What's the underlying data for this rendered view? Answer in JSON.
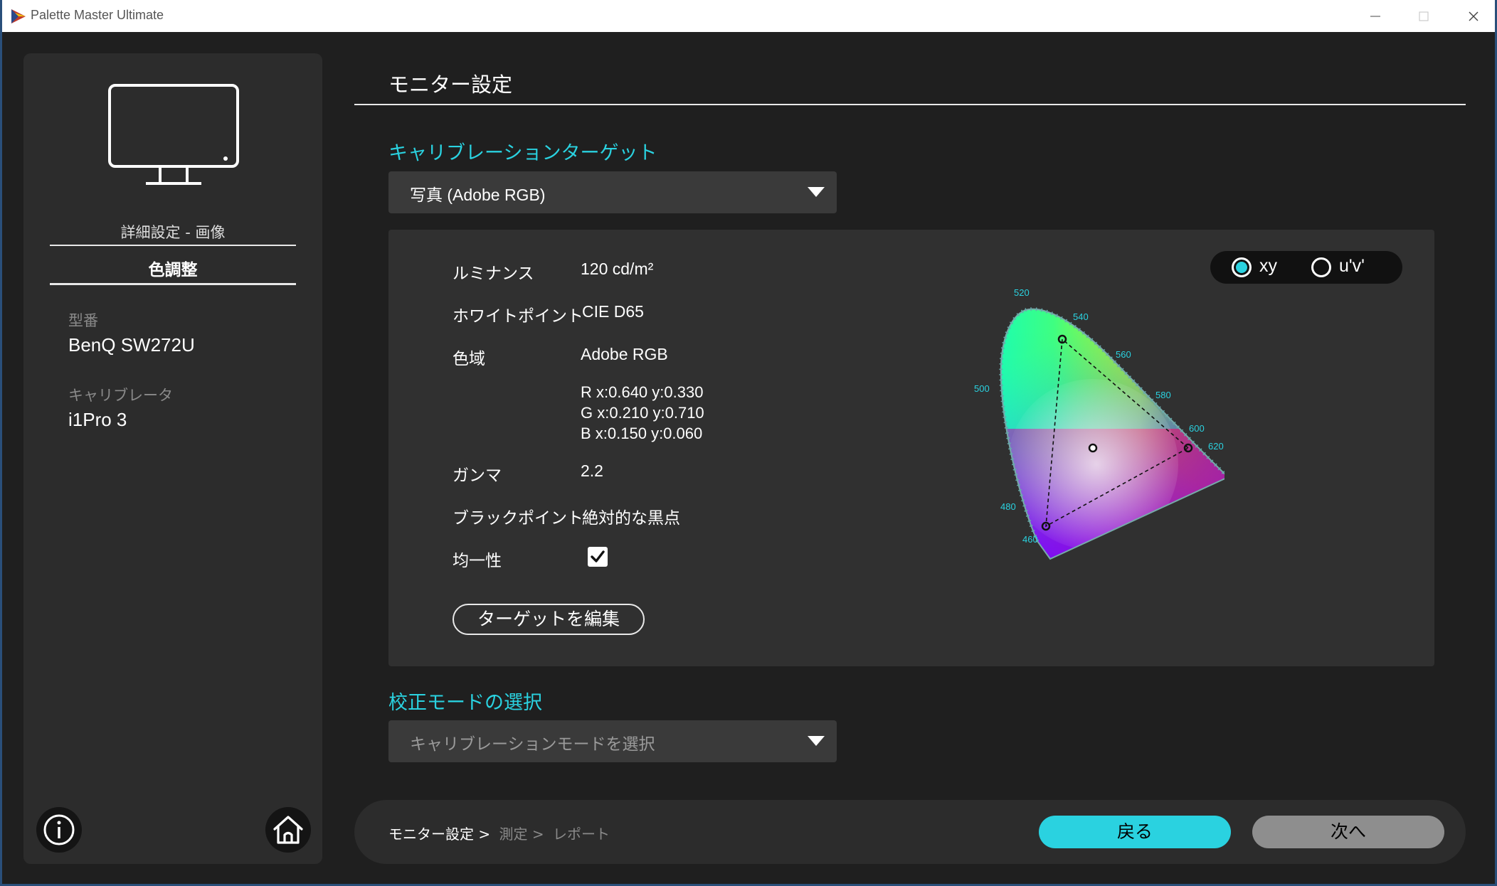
{
  "window": {
    "title": "Palette Master Ultimate"
  },
  "sidebar": {
    "breadcrumb": "詳細設定 - 画像",
    "section": "色調整",
    "model_label": "型番",
    "model_value": "BenQ SW272U",
    "calibrator_label": "キャリブレータ",
    "calibrator_value": "i1Pro 3"
  },
  "main": {
    "title": "モニター設定",
    "target_heading": "キャリブレーションターゲット",
    "target_selected": "写真 (Adobe RGB)",
    "mode_heading": "校正モードの選択",
    "mode_placeholder": "キャリブレーションモードを選択"
  },
  "target_details": {
    "luminance_label": "ルミナンス",
    "luminance_value": "120 cd/m²",
    "whitepoint_label": "ホワイトポイント",
    "whitepoint_value": "CIE D65",
    "gamut_label": "色域",
    "gamut_value": "Adobe RGB",
    "primary_r": "R x:0.640 y:0.330",
    "primary_g": "G x:0.210 y:0.710",
    "primary_b": "B x:0.150 y:0.060",
    "gamma_label": "ガンマ",
    "gamma_value": "2.2",
    "blackpoint_label": "ブラックポイント",
    "blackpoint_value": "絶対的な黒点",
    "uniformity_label": "均一性",
    "uniformity_checked": true,
    "edit_button": "ターゲットを編集"
  },
  "chart_toggle": {
    "option_xy": "xy",
    "option_uv": "u'v'",
    "selected": "xy"
  },
  "cie_diagram": {
    "wavelength_labels": [
      "520",
      "540",
      "560",
      "580",
      "600",
      "620",
      "500",
      "480",
      "460"
    ],
    "triangle": {
      "r": [
        0.64,
        0.33
      ],
      "g": [
        0.21,
        0.71
      ],
      "b": [
        0.15,
        0.06
      ]
    },
    "white_point": [
      0.3127,
      0.329
    ]
  },
  "footer": {
    "step1": "モニター設定 >",
    "step2": "測定 >",
    "step3": "レポート",
    "back_button": "戻る",
    "next_button": "次へ"
  },
  "colors": {
    "accent": "#2ad2e0",
    "background": "#1f1f1f",
    "panel": "#303030",
    "sidebar": "#2c2c2c"
  }
}
